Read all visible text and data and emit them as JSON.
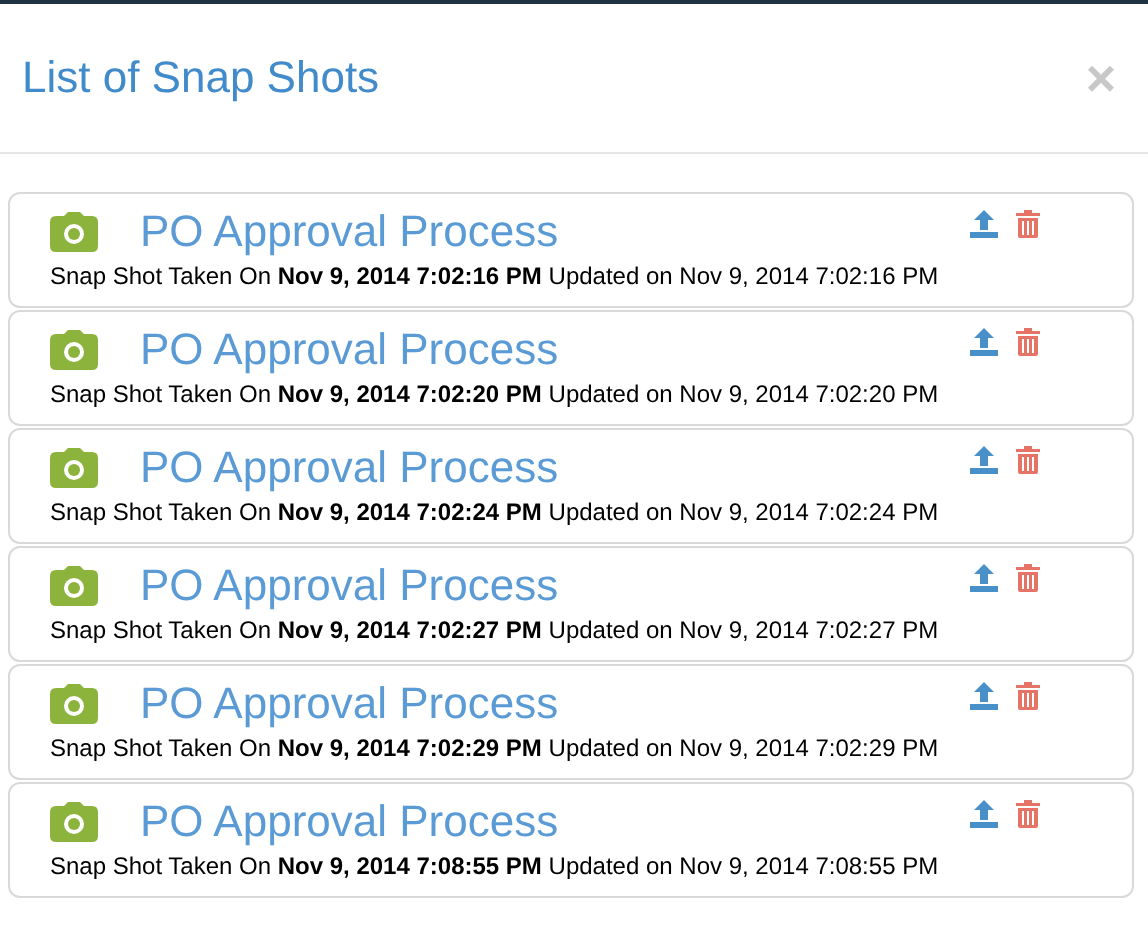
{
  "dialog": {
    "title": "List of Snap Shots",
    "close": "×"
  },
  "snapshots": [
    {
      "title": "PO Approval Process",
      "detail": "Snap Shot Taken On **Nov 9, 2014 7:02:16 PM** Updated on Nov 9, 2014 7:02:16 PM"
    },
    {
      "title": "PO Approval Process",
      "detail": "Snap Shot Taken On **Nov 9, 2014 7:02:20 PM** Updated on Nov 9, 2014 7:02:20 PM"
    },
    {
      "title": "PO Approval Process",
      "detail": "Snap Shot Taken On **Nov 9, 2014 7:02:24 PM** Updated on Nov 9, 2014 7:02:24 PM"
    },
    {
      "title": "PO Approval Process",
      "detail": "Snap Shot Taken On **Nov 9, 2014 7:02:27 PM** Updated on Nov 9, 2014 7:02:27 PM"
    },
    {
      "title": "PO Approval Process",
      "detail": "Snap Shot Taken On **Nov 9, 2014 7:02:29 PM** Updated on Nov 9, 2014 7:02:29 PM"
    },
    {
      "title": "PO Approval Process",
      "detail": "Snap Shot Taken On **Nov 9, 2014 7:08:55 PM** Updated on Nov 9, 2014 7:08:55 PM"
    }
  ]
}
